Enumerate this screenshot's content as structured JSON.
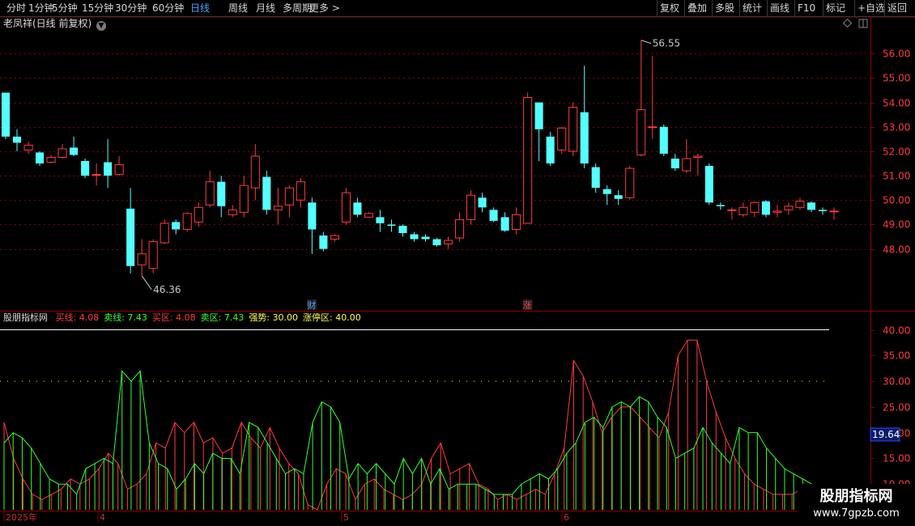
{
  "toolbar": {
    "periods": [
      "分时",
      "1分钟",
      "5分钟",
      "15分钟",
      "30分钟",
      "60分钟",
      "日线",
      "周线",
      "月线",
      "多周期",
      "更多 >"
    ],
    "active_period": "日线",
    "actions": [
      "复权",
      "叠加",
      "多股",
      "统计",
      "画线",
      "F10",
      "标记",
      "+自选",
      "返回"
    ]
  },
  "stock": {
    "title": "老凤祥(日线 前复权)",
    "high_label": "56.55",
    "low_label": "46.36",
    "markers": [
      {
        "text": "财",
        "color": "#4ea0ff"
      },
      {
        "text": "涨",
        "color": "#ff4040"
      }
    ]
  },
  "indicator": {
    "name": "股朋指标网",
    "items": [
      {
        "label": "买线: 4.08",
        "color": "#ff3b3b"
      },
      {
        "label": "卖线: 7.43",
        "color": "#33ff33"
      },
      {
        "label": "买区: 4.08",
        "color": "#ff3b3b"
      },
      {
        "label": "卖区: 7.43",
        "color": "#33ff33"
      },
      {
        "label": "强势: 30.00",
        "color": "#ffff40"
      },
      {
        "label": "涨停区: 40.00",
        "color": "#ffff40"
      }
    ],
    "current_value": "19.64"
  },
  "time_axis": {
    "labels": [
      "2025年",
      "4",
      "5",
      "6"
    ]
  },
  "watermark": {
    "line1": "股朋指标网",
    "line2": "www.7gpzb.com"
  },
  "colors": {
    "up": "#ff3b3b",
    "down": "#54ffff",
    "buy_line": "#ff3b3b",
    "sell_line": "#33ff33",
    "grid": "#8b0000",
    "axis_text": "#ff3b3b"
  },
  "chart_data": [
    {
      "type": "candlestick",
      "y_axis_ticks": [
        56.0,
        55.0,
        54.0,
        53.0,
        52.0,
        51.0,
        50.0,
        49.0,
        48.0
      ],
      "ylim": [
        45.8,
        57.2
      ],
      "candles": [
        [
          54.4,
          52.6,
          54.4,
          52.5
        ],
        [
          52.6,
          52.35,
          52.9,
          52.0
        ],
        [
          52.05,
          52.25,
          52.4,
          51.9
        ],
        [
          51.95,
          51.5,
          52.0,
          51.4
        ],
        [
          51.55,
          51.75,
          51.85,
          51.5
        ],
        [
          51.75,
          52.1,
          52.3,
          51.7
        ],
        [
          52.15,
          51.85,
          52.6,
          51.8
        ],
        [
          51.6,
          51.0,
          51.7,
          50.9
        ],
        [
          51.05,
          51.05,
          51.5,
          50.6
        ],
        [
          51.55,
          51.0,
          52.5,
          50.5
        ],
        [
          51.05,
          51.45,
          51.8,
          51.0
        ],
        [
          49.65,
          47.3,
          50.5,
          47.0
        ],
        [
          47.35,
          47.8,
          48.4,
          46.9
        ],
        [
          47.2,
          48.3,
          48.4,
          47.0
        ],
        [
          48.25,
          49.05,
          49.2,
          48.2
        ],
        [
          49.1,
          48.8,
          49.2,
          48.6
        ],
        [
          48.8,
          49.45,
          49.5,
          48.7
        ],
        [
          49.1,
          49.7,
          49.9,
          48.9
        ],
        [
          49.8,
          50.75,
          51.2,
          49.7
        ],
        [
          50.75,
          49.75,
          51.0,
          49.3
        ],
        [
          49.4,
          49.6,
          49.8,
          49.3
        ],
        [
          49.5,
          50.6,
          51.0,
          49.3
        ],
        [
          50.5,
          51.8,
          52.3,
          50.0
        ],
        [
          50.95,
          49.6,
          51.2,
          49.4
        ],
        [
          49.6,
          49.75,
          50.5,
          49.0
        ],
        [
          49.8,
          50.5,
          50.6,
          49.3
        ],
        [
          50.0,
          50.75,
          50.9,
          49.7
        ],
        [
          49.9,
          48.8,
          50.1,
          47.8
        ],
        [
          48.55,
          48.0,
          48.7,
          47.9
        ],
        [
          48.4,
          48.55,
          48.6,
          48.3
        ],
        [
          49.1,
          50.3,
          50.5,
          49.0
        ],
        [
          49.9,
          49.4,
          50.1,
          49.3
        ],
        [
          49.3,
          49.45,
          49.5,
          49.3
        ],
        [
          49.3,
          49.05,
          49.6,
          48.7
        ],
        [
          49.0,
          48.95,
          49.2,
          48.7
        ],
        [
          48.95,
          48.65,
          49.0,
          48.5
        ],
        [
          48.6,
          48.4,
          48.7,
          48.3
        ],
        [
          48.5,
          48.4,
          48.6,
          48.3
        ],
        [
          48.4,
          48.15,
          48.45,
          48.1
        ],
        [
          48.2,
          48.35,
          48.5,
          48.0
        ],
        [
          48.45,
          49.2,
          49.5,
          48.3
        ],
        [
          49.2,
          50.2,
          50.4,
          49.0
        ],
        [
          50.1,
          49.7,
          50.3,
          49.5
        ],
        [
          49.6,
          49.15,
          49.7,
          49.1
        ],
        [
          49.3,
          48.75,
          49.5,
          48.7
        ],
        [
          48.8,
          49.4,
          49.7,
          48.6
        ],
        [
          49.05,
          54.2,
          54.4,
          49.05
        ],
        [
          54.0,
          52.9,
          54.0,
          51.6
        ],
        [
          52.6,
          51.5,
          52.8,
          51.4
        ],
        [
          52.05,
          52.95,
          53.0,
          51.9
        ],
        [
          52.0,
          53.8,
          54.0,
          51.8
        ],
        [
          53.6,
          51.5,
          55.5,
          51.3
        ],
        [
          51.35,
          50.5,
          51.5,
          50.3
        ],
        [
          50.45,
          50.25,
          50.6,
          49.8
        ],
        [
          50.2,
          50.05,
          50.4,
          49.8
        ],
        [
          50.1,
          51.3,
          51.4,
          50.0
        ],
        [
          51.85,
          53.7,
          56.55,
          51.8
        ],
        [
          53.0,
          53.0,
          55.9,
          52.5
        ],
        [
          53.0,
          51.9,
          53.1,
          51.8
        ],
        [
          51.7,
          51.3,
          51.9,
          51.2
        ],
        [
          51.2,
          51.7,
          52.5,
          51.1
        ],
        [
          51.75,
          51.8,
          51.9,
          51.0
        ],
        [
          51.4,
          49.9,
          51.5,
          49.8
        ],
        [
          49.8,
          49.75,
          49.9,
          49.6
        ],
        [
          49.6,
          49.6,
          49.7,
          49.2
        ],
        [
          49.4,
          49.7,
          49.9,
          49.3
        ],
        [
          49.5,
          49.9,
          49.95,
          49.3
        ],
        [
          49.95,
          49.4,
          50.0,
          49.3
        ],
        [
          49.5,
          49.55,
          49.8,
          49.3
        ],
        [
          49.6,
          49.75,
          49.9,
          49.4
        ],
        [
          49.7,
          49.95,
          50.1,
          49.6
        ],
        [
          49.9,
          49.6,
          49.95,
          49.5
        ],
        [
          49.6,
          49.55,
          49.7,
          49.4
        ],
        [
          49.55,
          49.55,
          49.7,
          49.2
        ]
      ],
      "high_point": 56.55,
      "low_point": 46.36
    },
    {
      "type": "line",
      "title": "股朋指标网",
      "y_axis_ticks": [
        40.0,
        35.0,
        30.0,
        25.0,
        20.0,
        15.0,
        10.0
      ],
      "ylim": [
        5,
        41.5
      ],
      "reference_lines": [
        {
          "name": "强势",
          "value": 30.0
        },
        {
          "name": "涨停区",
          "value": 40.0
        }
      ],
      "series": [
        {
          "name": "买线",
          "values": [
            22,
            15,
            11,
            8,
            7,
            8,
            9,
            11,
            10,
            11,
            13,
            16,
            14,
            9,
            10,
            12,
            18,
            17,
            22,
            20,
            22,
            18,
            19,
            16,
            17,
            22,
            19,
            17,
            21,
            17,
            14,
            12,
            6,
            5,
            10,
            13,
            12,
            7,
            10,
            11,
            9,
            8,
            7,
            8,
            10,
            15,
            18,
            12,
            13,
            14,
            10,
            9,
            7,
            8,
            7,
            8,
            9,
            8,
            12,
            17,
            34,
            31,
            26,
            20,
            23,
            25,
            25,
            23,
            21,
            19,
            24,
            35,
            38,
            38,
            30,
            24,
            19,
            15,
            12,
            10,
            9,
            8,
            8,
            8,
            9,
            9,
            8,
            8
          ]
        },
        {
          "name": "卖线",
          "values": [
            18,
            20,
            19,
            17,
            14,
            11,
            10,
            10,
            8,
            13,
            14,
            15,
            14,
            32,
            30,
            32,
            18,
            14,
            13,
            9,
            11,
            14,
            12,
            16,
            15,
            15,
            12,
            22,
            21,
            18,
            15,
            12,
            13,
            12,
            22,
            26,
            25,
            22,
            11,
            14,
            12,
            14,
            12,
            10,
            15,
            12,
            15,
            10,
            13,
            9,
            10,
            10,
            10,
            9,
            8,
            8,
            8,
            10,
            11,
            12,
            11,
            13,
            16,
            18,
            22,
            23,
            21,
            25,
            26,
            25,
            27,
            26,
            23,
            21,
            15,
            16,
            17,
            21,
            18,
            16,
            14,
            21,
            20,
            20,
            17,
            15,
            13,
            12,
            11,
            10,
            9,
            7
          ]
        }
      ]
    }
  ]
}
